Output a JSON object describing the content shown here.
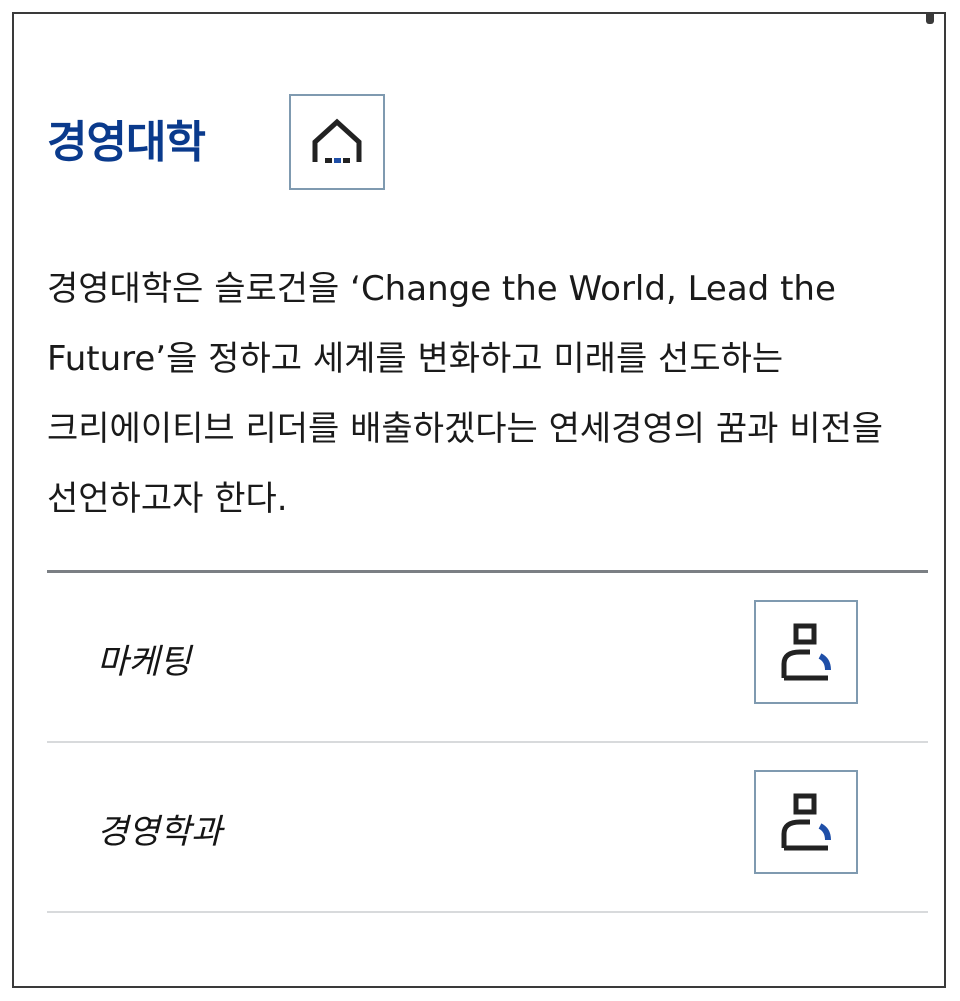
{
  "college": {
    "title": "경영대학",
    "home_icon": "home-icon",
    "description": "경영대학은 슬로건을 ‘Change the World, Lead the Future’을 정하고 세계를 변화하고 미래를 선도하는 크리에이티브 리더를 배출하겠다는 연세경영의 꿈과 비전을 선언하고자 한다."
  },
  "departments": [
    {
      "label": "마케팅",
      "icon": "person-icon"
    },
    {
      "label": "경영학과",
      "icon": "person-icon"
    }
  ],
  "colors": {
    "title": "#0a3a8c",
    "icon_accent": "#1f4fa8",
    "icon_border": "#7f9ab0",
    "divider": "#7b7f84"
  }
}
